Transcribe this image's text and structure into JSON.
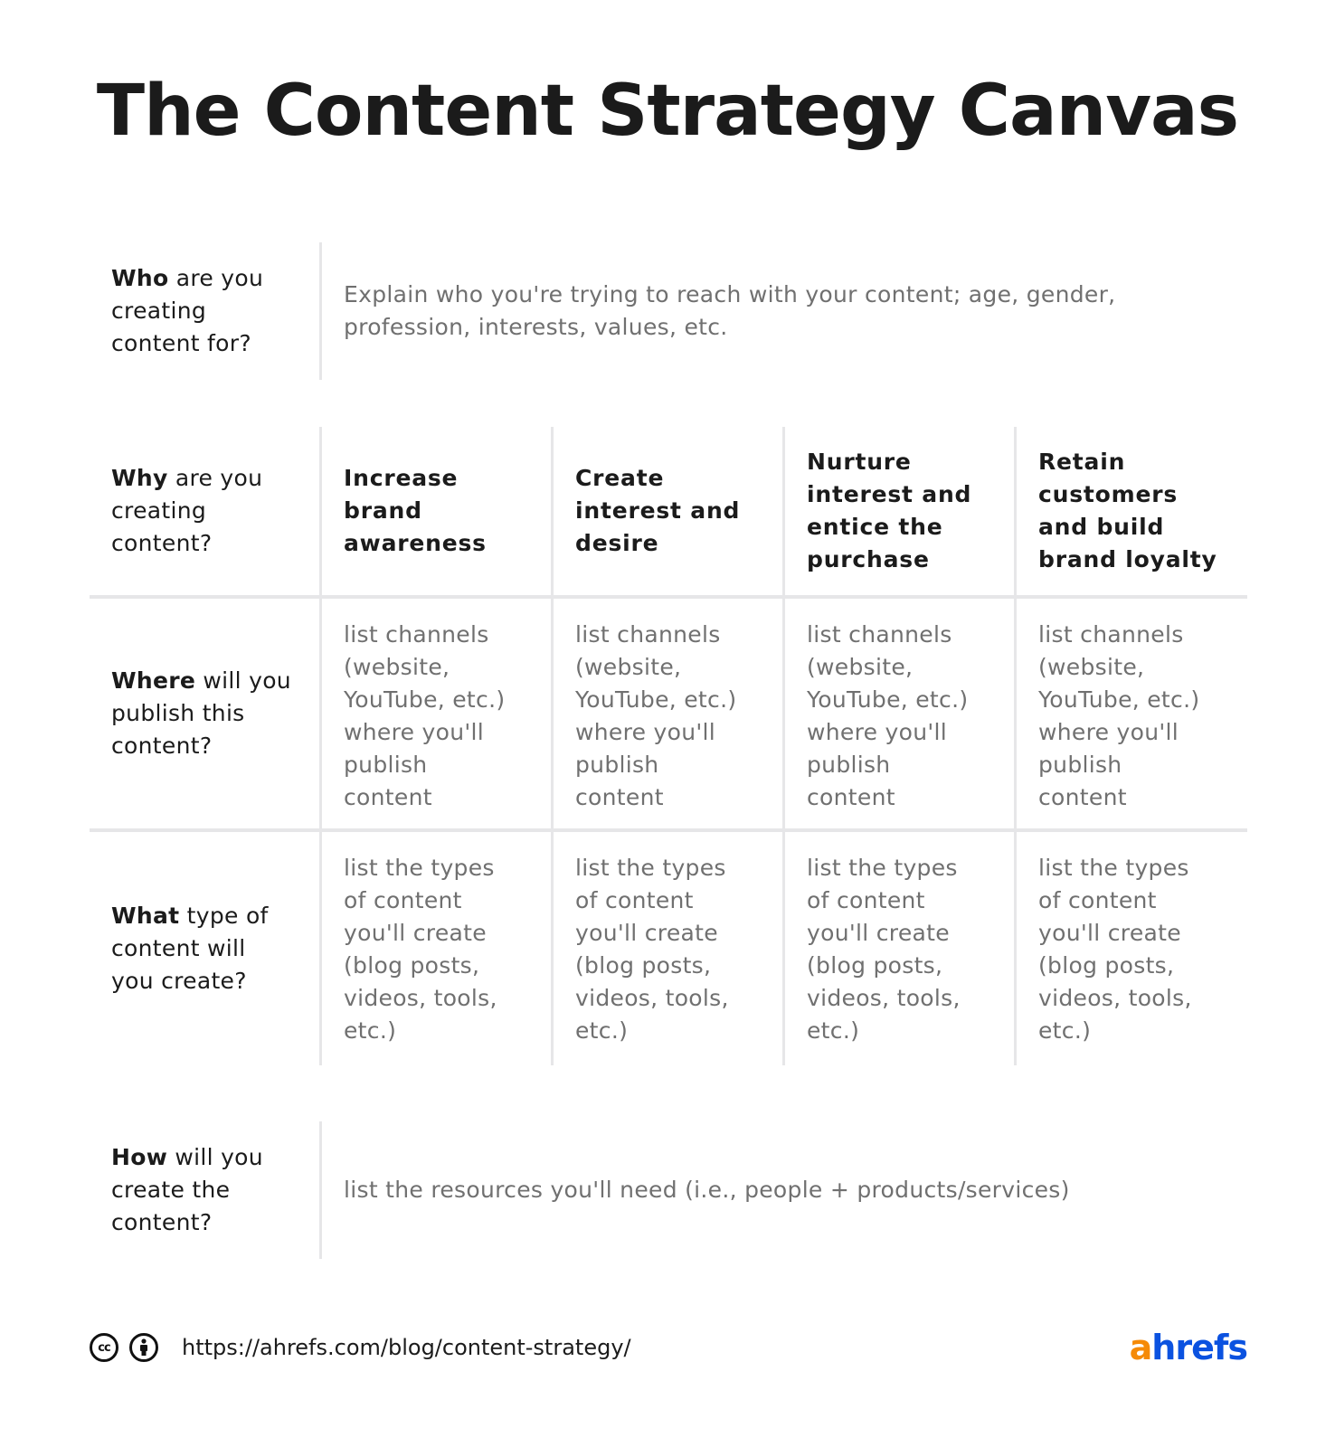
{
  "title": "The Content Strategy Canvas",
  "who": {
    "label_bold": "Who",
    "label_rest": " are you creating content for?",
    "value": "Explain who you're trying to reach with your content; age, gender, profession, interests, values, etc."
  },
  "grid": {
    "why": {
      "label_bold": "Why",
      "label_rest": " are you creating content?",
      "columns": [
        "Increase brand awareness",
        "Create interest and desire",
        "Nurture interest and entice the purchase",
        "Retain customers and build brand loyalty"
      ]
    },
    "where": {
      "label_bold": "Where",
      "label_rest": " will you publish this content?",
      "cells": [
        "list channels (website, YouTube, etc.) where you'll publish content",
        "list channels (website, YouTube, etc.) where you'll publish content",
        "list channels (website, YouTube, etc.) where you'll publish content",
        "list channels (website, YouTube, etc.) where you'll publish content"
      ]
    },
    "what": {
      "label_bold": "What",
      "label_rest": " type of content will you create?",
      "cells": [
        "list the types of content you'll create (blog posts, videos, tools, etc.)",
        "list the types of content you'll create (blog posts, videos, tools, etc.)",
        "list the types of content you'll create (blog posts, videos, tools, etc.)",
        "list the types of content you'll create (blog posts, videos, tools, etc.)"
      ]
    }
  },
  "how": {
    "label_bold": "How",
    "label_rest": " will you create the content?",
    "value": "list the resources you'll need (i.e., people + products/services)"
  },
  "footer": {
    "cc_icon": "cc",
    "attribution_icon": "person-info",
    "url": "https://ahrefs.com/blog/content-strategy/",
    "logo_a": "a",
    "logo_rest": "hrefs",
    "colors": {
      "logo_orange": "#f58a07",
      "logo_blue": "#0b52e0"
    }
  }
}
